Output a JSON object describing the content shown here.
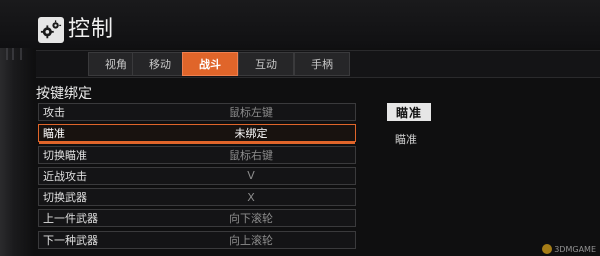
{
  "header": {
    "title": "控制"
  },
  "tabs": [
    {
      "label": "视角",
      "active": false
    },
    {
      "label": "移动",
      "active": false
    },
    {
      "label": "战斗",
      "active": true
    },
    {
      "label": "互动",
      "active": false
    },
    {
      "label": "手柄",
      "active": false
    }
  ],
  "bindings": {
    "section_title": "按键绑定",
    "rows": [
      {
        "action": "攻击",
        "key": "鼠标左键"
      },
      {
        "action": "瞄准",
        "key": "未绑定"
      },
      {
        "action": "切换瞄准",
        "key": "鼠标右键"
      },
      {
        "action": "近战攻击",
        "key": "V"
      },
      {
        "action": "切换武器",
        "key": "X"
      },
      {
        "action": "上一件武器",
        "key": "向下滚轮"
      },
      {
        "action": "下一种武器",
        "key": "向上滚轮"
      }
    ]
  },
  "detail": {
    "title": "瞄准",
    "description": "瞄准"
  },
  "watermark": {
    "text": "3DMGAME"
  },
  "colors": {
    "accent": "#e0652a",
    "background": "#0f0f10"
  },
  "icons": {
    "title_icon": "gear-icon"
  }
}
